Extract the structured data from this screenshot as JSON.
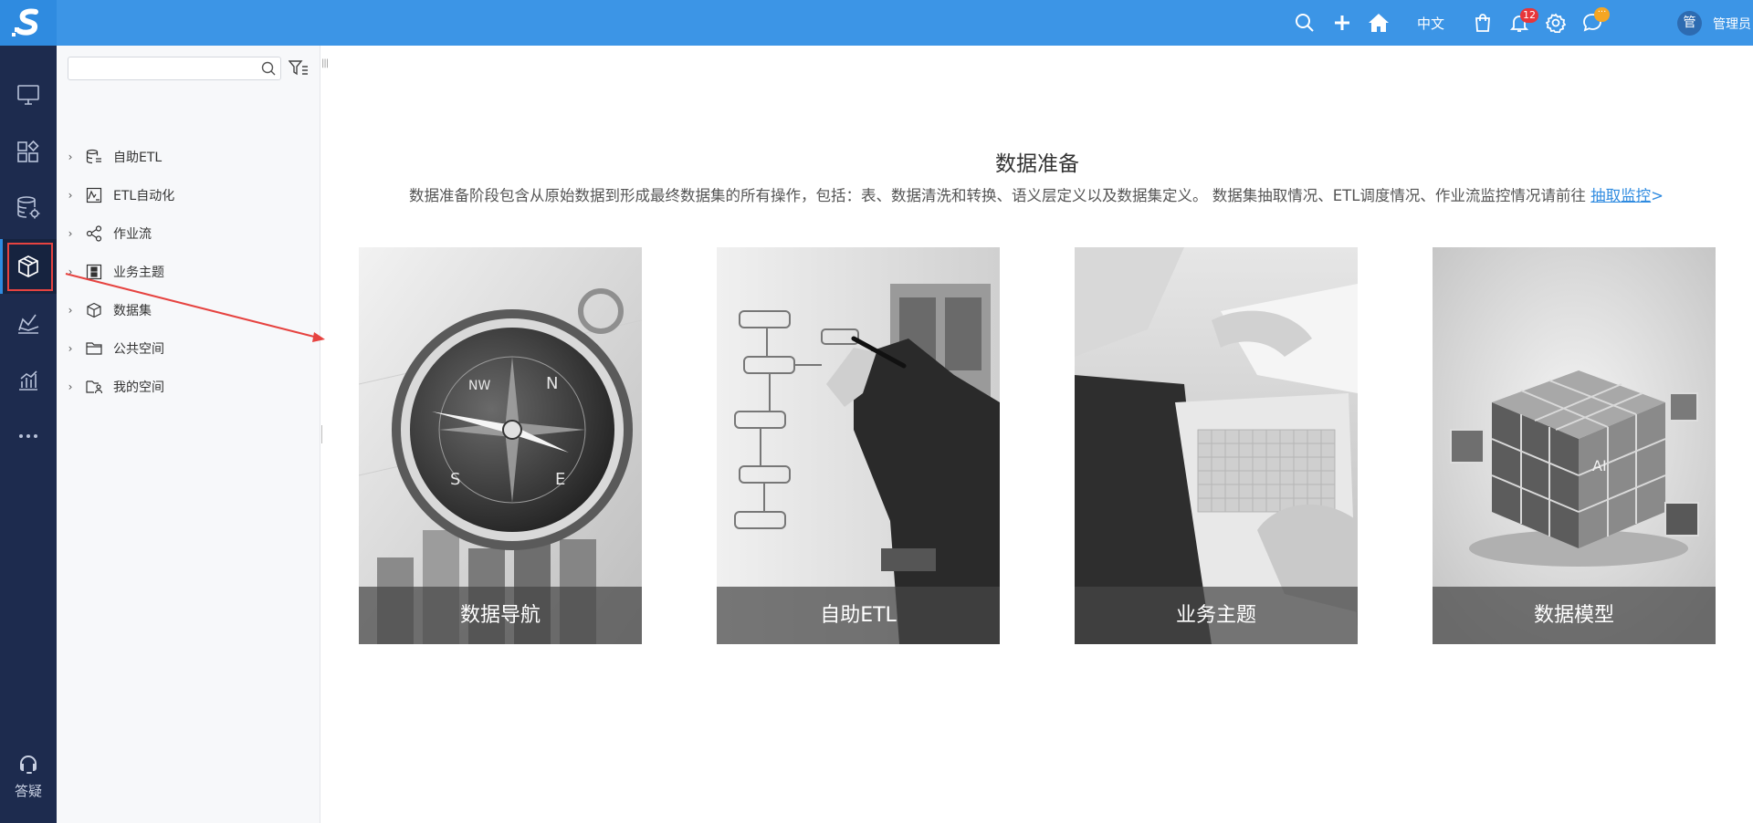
{
  "topbar": {
    "language": "中文",
    "notification_count": "12",
    "message_badge": "···",
    "avatar_text": "管",
    "user_name": "管理员"
  },
  "rail": {
    "help_label": "答疑"
  },
  "tree": {
    "search_value": "",
    "items": [
      {
        "label": "自助ETL"
      },
      {
        "label": "ETL自动化"
      },
      {
        "label": "作业流"
      },
      {
        "label": "业务主题"
      },
      {
        "label": "数据集"
      },
      {
        "label": "公共空间"
      },
      {
        "label": "我的空间"
      }
    ]
  },
  "main": {
    "title": "数据准备",
    "description": "数据准备阶段包含从原始数据到形成最终数据集的所有操作，包括：表、数据清洗和转换、语义层定义以及数据集定义。 数据集抽取情况、ETL调度情况、作业流监控情况请前往 ",
    "link_text": "抽取监控",
    "link_suffix": ">",
    "cards": [
      {
        "label": "数据导航"
      },
      {
        "label": "自助ETL"
      },
      {
        "label": "业务主题"
      },
      {
        "label": "数据模型"
      }
    ]
  },
  "colors": {
    "rail_bg": "#1d2b4e",
    "topbar_bg": "#3c95e6",
    "accent": "#2f8be0",
    "highlight_red": "#e64340"
  }
}
